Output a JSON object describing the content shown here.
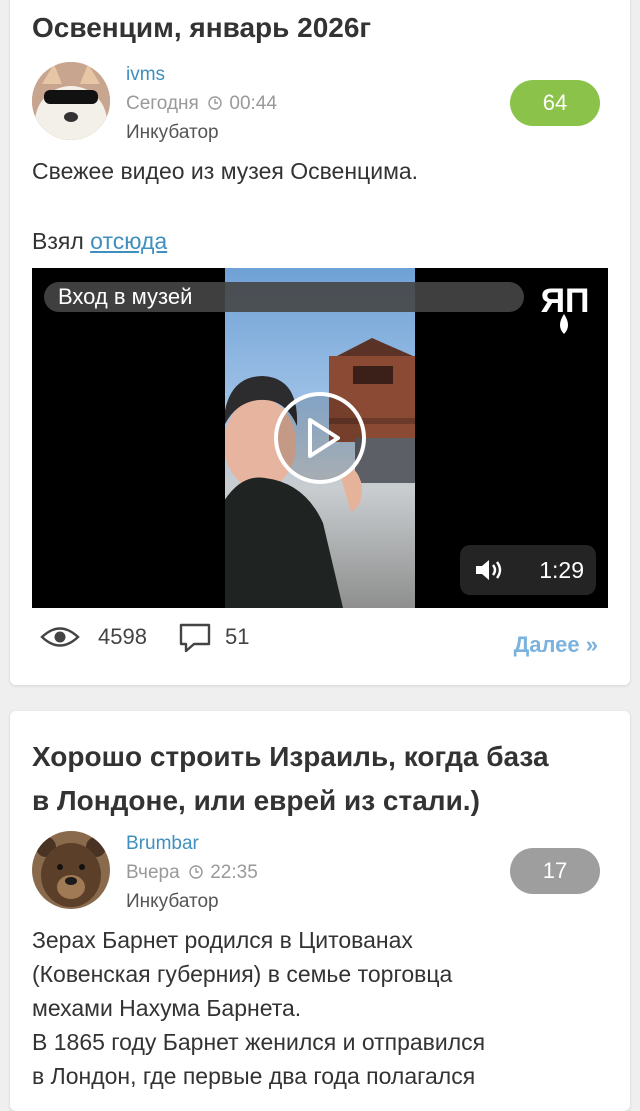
{
  "posts": [
    {
      "title": "Освенцим, январь 2026г",
      "author": "ivms",
      "date_label": "Сегодня",
      "time": "00:44",
      "rubric": "Инкубатор",
      "rating": "64",
      "rating_color": "#8bc34a",
      "text_line1": "Свежее видео из музея Освенцима.",
      "text_prefix": "Взял",
      "text_link": "отсюда",
      "video": {
        "title": "Вход в музей",
        "duration": "1:29",
        "logo_text": "ЯП"
      },
      "views": "4598",
      "comments": "51",
      "more_label": "Далее »"
    },
    {
      "title_line1": "Хорошо строить Израиль, когда база",
      "title_line2": "в Лондоне, или еврей из стали.)",
      "author": "Brumbar",
      "date_label": "Вчера",
      "time": "22:35",
      "rubric": "Инкубатор",
      "rating": "17",
      "rating_color": "#9e9e9e",
      "text_lines": [
        "Зерах Барнет родился в Цитованах",
        "(Ковенская губерния) в семье торговца",
        "мехами Нахума Барнета.",
        "В 1865 году Барнет женился и отправился",
        "в Лондон, где первые два года полагался"
      ]
    }
  ]
}
